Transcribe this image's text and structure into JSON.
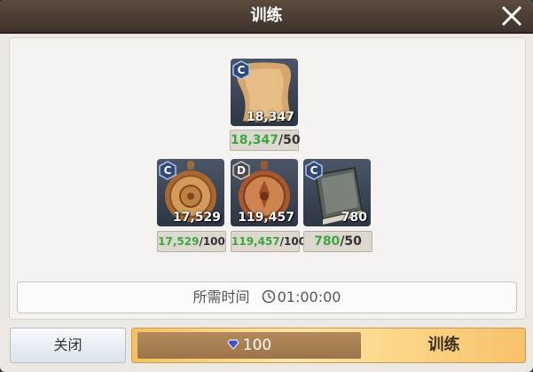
{
  "title": "训练",
  "items": {
    "scroll": {
      "grade": "C",
      "quantity": "18,347",
      "have": "18,347",
      "need": "/50",
      "icon": "parchment-scroll-icon"
    },
    "medal_c": {
      "grade": "C",
      "quantity": "17,529",
      "have": "17,529",
      "need": "/100",
      "icon": "bronze-medal-icon"
    },
    "medal_d": {
      "grade": "D",
      "quantity": "119,457",
      "have": "119,457",
      "need": "/100",
      "icon": "copper-medal-icon"
    },
    "book": {
      "grade": "C",
      "quantity": "780",
      "have": "780",
      "need": "/50",
      "icon": "book-icon"
    }
  },
  "time": {
    "label": "所需时间",
    "value": "01:00:00"
  },
  "buttons": {
    "close": "关闭",
    "cost": "100",
    "train": "训练"
  },
  "colors": {
    "have": "#3ca83c",
    "train_button": "#ffe7a5",
    "cost_bar": "#a87e50"
  }
}
